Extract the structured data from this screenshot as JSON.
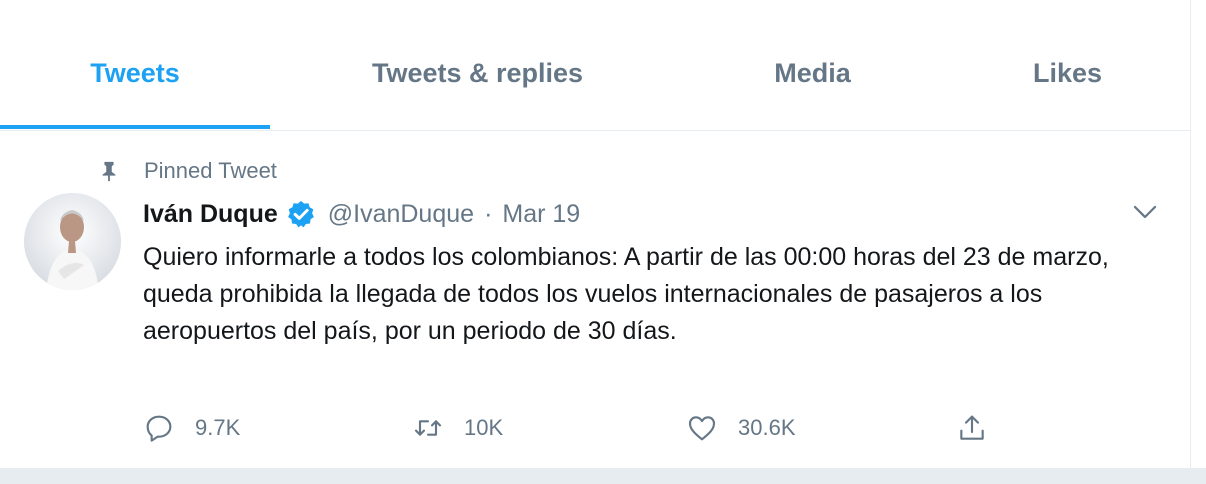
{
  "tabs": [
    {
      "label": "Tweets",
      "active": true
    },
    {
      "label": "Tweets & replies",
      "active": false
    },
    {
      "label": "Media",
      "active": false
    },
    {
      "label": "Likes",
      "active": false
    }
  ],
  "tweet": {
    "pinned_label": "Pinned Tweet",
    "author_name": "Iván Duque",
    "handle": "@IvanDuque",
    "separator": "·",
    "date": "Mar 19",
    "text": "Quiero informarle a todos los colombianos: A partir de las 00:00 horas del 23 de marzo, queda prohibida la llegada de todos los vuelos internacionales de pasajeros a los aeropuertos del país, por un periodo de 30 días.",
    "replies": "9.7K",
    "retweets": "10K",
    "likes": "30.6K"
  },
  "icons": {
    "pin": "pin-icon",
    "verified": "verified-badge-icon",
    "more": "chevron-down-icon",
    "reply": "reply-icon",
    "retweet": "retweet-icon",
    "like": "heart-icon",
    "share": "share-icon"
  },
  "colors": {
    "accent": "#1da1f2",
    "text_primary": "#14171a",
    "text_secondary": "#657786",
    "border": "#e6ecf0"
  }
}
